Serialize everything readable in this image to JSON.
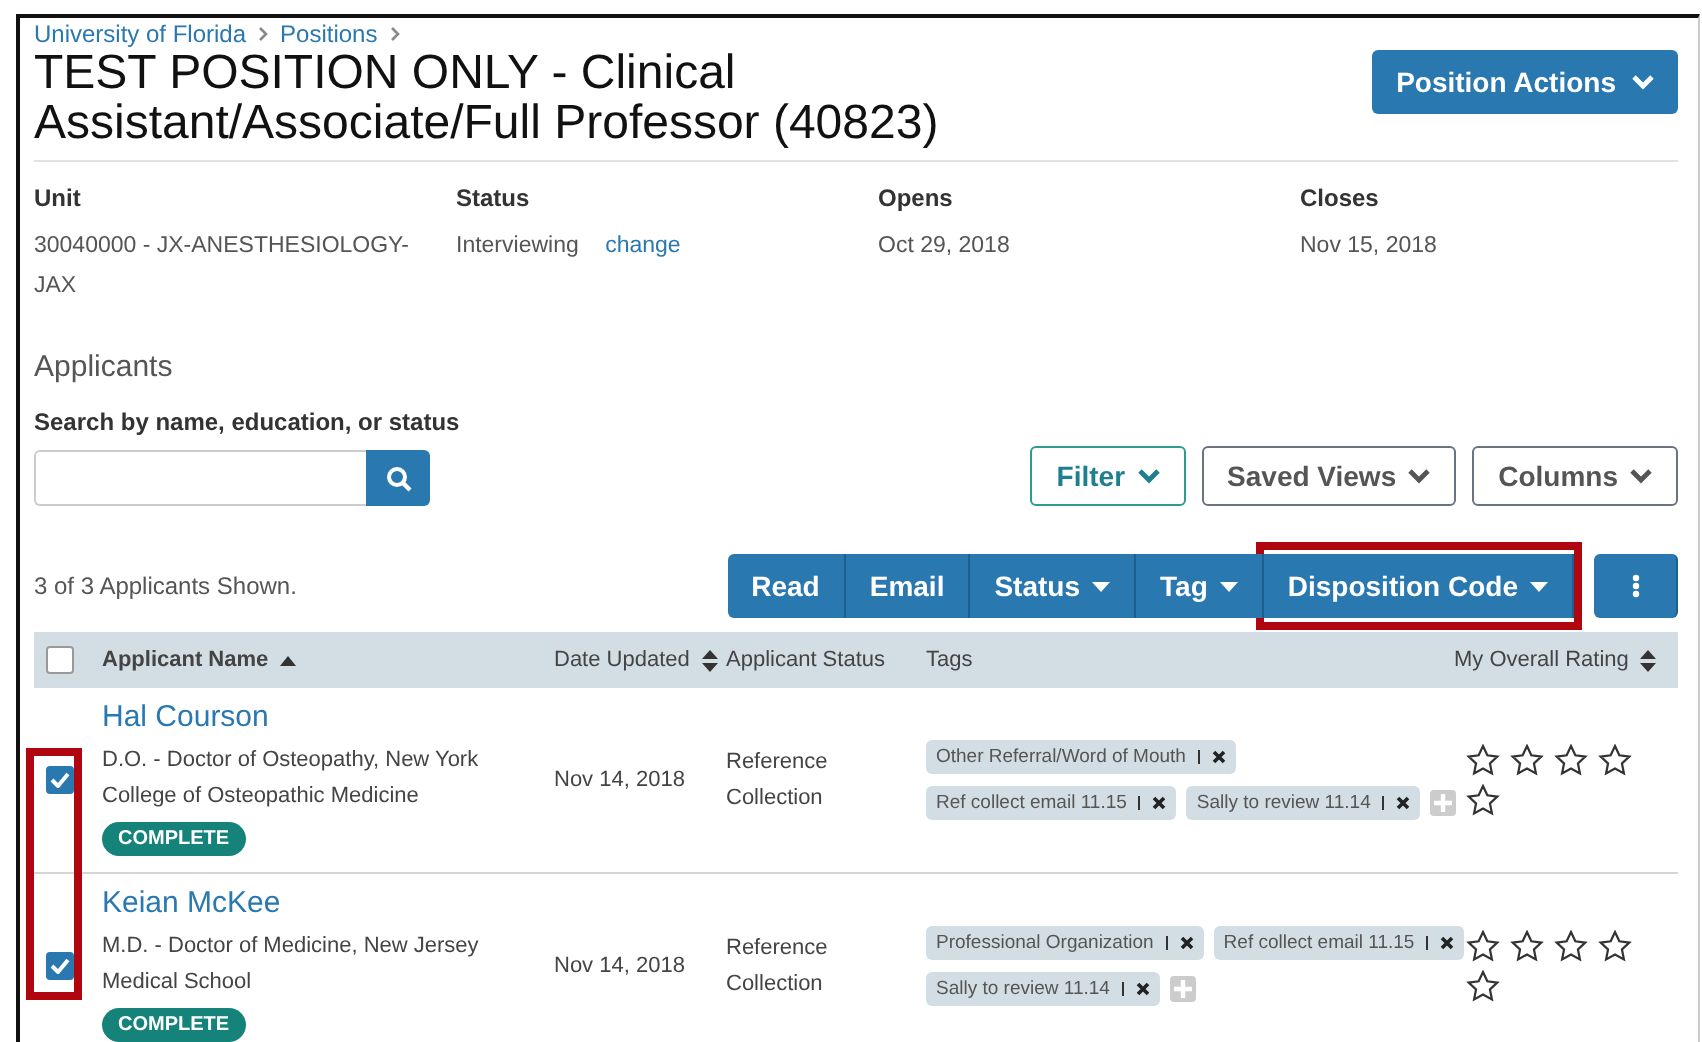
{
  "breadcrumbs": [
    "University of Florida",
    "Positions"
  ],
  "title": "TEST POSITION ONLY - Clinical Assistant/Associate/Full Professor (40823)",
  "position_actions": "Position Actions",
  "details": [
    {
      "label": "Unit",
      "value": "30040000 - JX-ANESTHESIOLOGY-JAX"
    },
    {
      "label": "Status",
      "value": "Interviewing",
      "link": "change"
    },
    {
      "label": "Opens",
      "value": "Oct 29, 2018"
    },
    {
      "label": "Closes",
      "value": "Nov 15, 2018"
    }
  ],
  "section_title": "Applicants",
  "search": {
    "label": "Search by name, education, or status"
  },
  "view_buttons": [
    {
      "label": "Filter",
      "kind": "accent"
    },
    {
      "label": "Saved Views",
      "kind": "plain"
    },
    {
      "label": "Columns",
      "kind": "plain"
    }
  ],
  "count": "3 of 3 Applicants Shown.",
  "actions": [
    {
      "label": "Read",
      "dropdown": false,
      "highlighted": false
    },
    {
      "label": "Email",
      "dropdown": false,
      "highlighted": false
    },
    {
      "label": "Status",
      "dropdown": true,
      "highlighted": false
    },
    {
      "label": "Tag",
      "dropdown": true,
      "highlighted": false
    },
    {
      "label": "Disposition Code",
      "dropdown": true,
      "highlighted": true
    }
  ],
  "table": {
    "checkbox_column_highlighted": true,
    "all_checked": false,
    "columns": [
      {
        "label": "Applicant Name",
        "sortable": true,
        "sorted": true
      },
      {
        "label": "Date Updated",
        "sortable": true,
        "sorted": false
      },
      {
        "label": "Applicant Status",
        "sortable": false
      },
      {
        "label": "Tags",
        "sortable": false
      },
      {
        "label": "My Overall Rating",
        "sortable": true,
        "sorted": false
      }
    ],
    "rows": [
      {
        "checked": true,
        "name": "Hal Courson",
        "education": "D.O. - Doctor of Osteopathy, New York College of Osteopathic Medicine",
        "badge": "COMPLETE",
        "date": "Nov 14, 2018",
        "status": "Reference Collection",
        "tags": [
          "Other Referral/Word of Mouth",
          "Ref collect email 11.15",
          "Sally to review 11.14"
        ],
        "stars": 0
      },
      {
        "checked": true,
        "name": "Keian McKee",
        "education": "M.D. - Doctor of Medicine, New Jersey Medical School",
        "badge": "COMPLETE",
        "date": "Nov 14, 2018",
        "status": "Reference Collection",
        "tags": [
          "Professional Organization",
          "Ref collect email 11.15",
          "Sally to review 11.14"
        ],
        "stars": 0
      }
    ]
  }
}
